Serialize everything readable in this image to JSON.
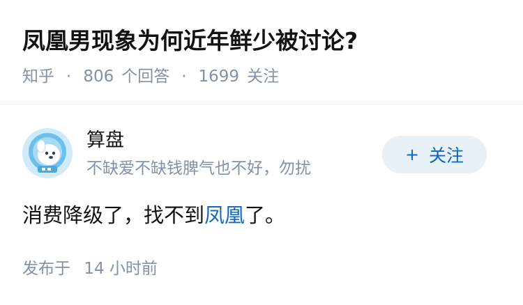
{
  "question": {
    "title": "凤凰男现象为何近年鲜少被讨论?",
    "source": "知乎",
    "separator": "·",
    "answer_count": "806",
    "answer_label": "个回答",
    "follow_count": "1699",
    "follow_label": "关注"
  },
  "author": {
    "avatar_icon": "dog-astronaut-avatar",
    "name": "算盘",
    "bio": "不缺爱不缺钱脾气也不好，勿扰",
    "follow_button": {
      "icon": "+",
      "label": "关注"
    }
  },
  "answer": {
    "text_before": "消费降级了，找不到",
    "link_text": "凤凰",
    "text_after": "了。"
  },
  "publish": {
    "label": "发布于",
    "time": "14 小时前"
  },
  "colors": {
    "title": "#121212",
    "meta": "#8590a6",
    "link": "#1068bf",
    "follow_button_bg": "#e8f0f8",
    "follow_button_text": "#0b66c2",
    "avatar_bg": "#dff1fb"
  }
}
